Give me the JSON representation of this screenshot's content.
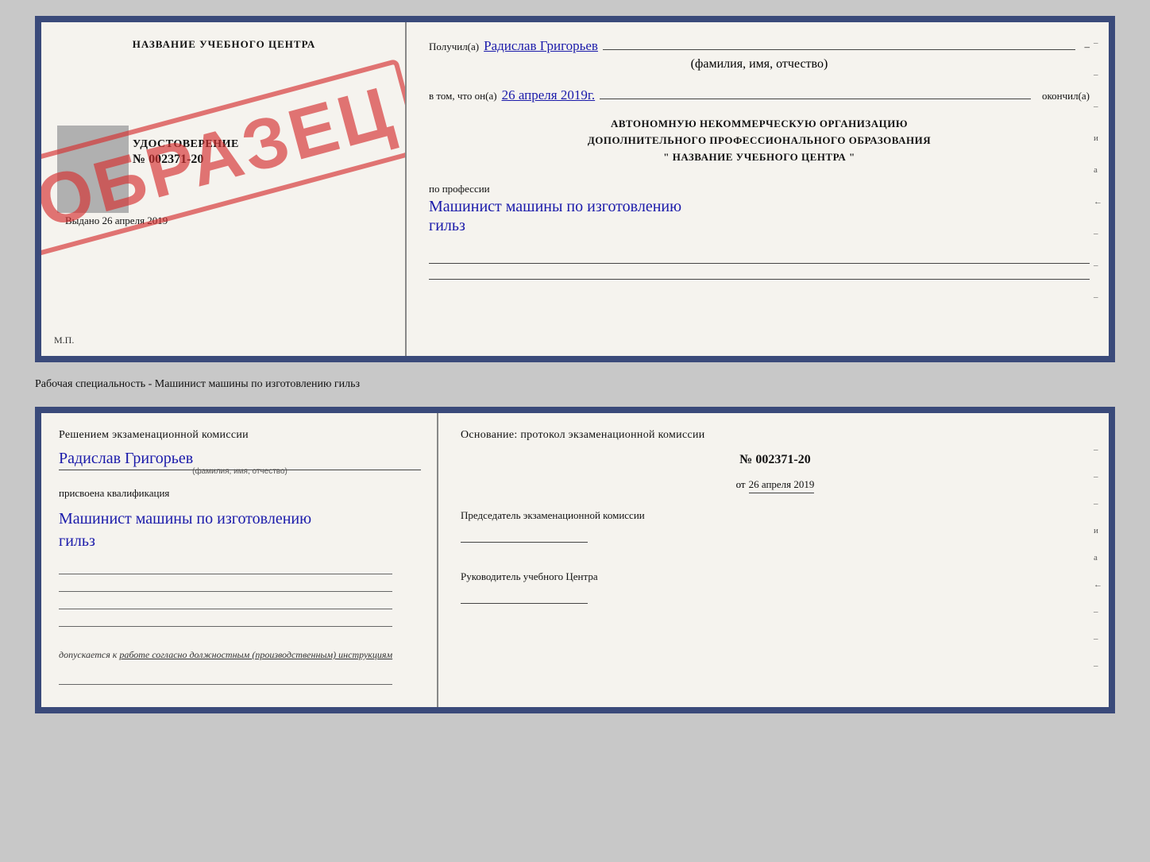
{
  "certTop": {
    "leftPanel": {
      "centerTitle": "НАЗВАНИЕ УЧЕБНОГО ЦЕНТРА",
      "udogTitle": "УДОСТОВЕРЕНИЕ",
      "udogNum": "№ 002371-20",
      "vydano": "Выдано",
      "vydanoDate": "26 апреля 2019",
      "mp": "М.П.",
      "stamp": "ОБРАЗЕЦ"
    },
    "rightPanel": {
      "poluchilLabel": "Получил(а)",
      "poluchilName": "Радислав Григорьев",
      "fioLabel": "(фамилия, имя, отчество)",
      "vtomLabel": "в том, что он(а)",
      "vtomDate": "26 апреля 2019г.",
      "okonchilLabel": "окончил(а)",
      "orgLine1": "АВТОНОМНУЮ НЕКОММЕРЧЕСКУЮ ОРГАНИЗАЦИЮ",
      "orgLine2": "ДОПОЛНИТЕЛЬНОГО ПРОФЕССИОНАЛЬНОГО ОБРАЗОВАНИЯ",
      "orgLine3": "\"   НАЗВАНИЕ УЧЕБНОГО ЦЕНТРА   \"",
      "poProf": "по профессии",
      "profession1": "Машинист машины по изготовлению",
      "profession2": "гильз",
      "sideMarks": [
        "–",
        "–",
        "–",
        "и",
        "а",
        "←",
        "–",
        "–",
        "–"
      ]
    }
  },
  "specialtyLabel": "Рабочая специальность - Машинист машины по изготовлению гильз",
  "certBottom": {
    "leftPanel": {
      "reshenieTitle": "Решением  экзаменационной  комиссии",
      "personName": "Радислав Григорьев",
      "fioLabel": "(фамилия, имя, отчество)",
      "prisvoyenaText": "присвоена квалификация",
      "profession1": "Машинист машины по изготовлению",
      "profession2": "гильз",
      "dopuskaetsyaLabel": "допускается к",
      "dopuskaetsyaText": "работе согласно должностным (производственным) инструкциям"
    },
    "rightPanel": {
      "osnovaniyeTitle": "Основание: протокол экзаменационной  комиссии",
      "protoNum": "№  002371-20",
      "protoDatePrefix": "от",
      "protoDate": "26 апреля 2019",
      "predsedatelTitle": "Председатель экзаменационной комиссии",
      "rukovTitle": "Руководитель учебного Центра",
      "sideMarks": [
        "–",
        "–",
        "–",
        "и",
        "а",
        "←",
        "–",
        "–",
        "–"
      ]
    }
  }
}
